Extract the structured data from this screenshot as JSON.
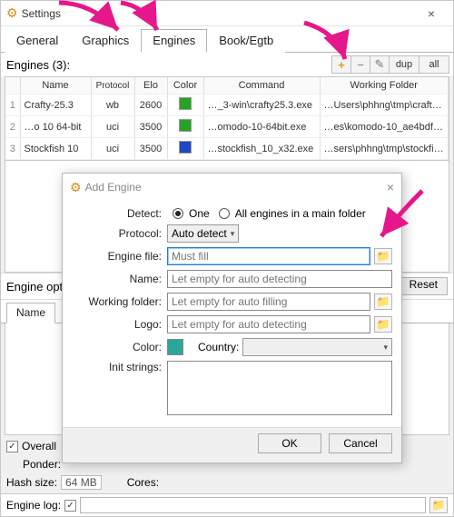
{
  "window": {
    "title": "Settings"
  },
  "tabs": [
    "General",
    "Graphics",
    "Engines",
    "Book/Egtb"
  ],
  "active_tab_index": 2,
  "engines_bar": {
    "label": "Engines (3):",
    "buttons": {
      "plus": "+",
      "minus": "−",
      "edit": "✎",
      "dup": "dup",
      "all": "all"
    }
  },
  "columns": [
    "",
    "Name",
    "Protocol",
    "Elo",
    "Color",
    "Command",
    "Working Folder"
  ],
  "rows": [
    {
      "i": "1",
      "name": "Crafty-25.3",
      "proto": "wb",
      "elo": "2600",
      "color": "#26a326",
      "cmd": "…_3-win\\crafty25.3.exe",
      "wf": "…Users\\phhng\\tmp\\crafty-25_3-win"
    },
    {
      "i": "2",
      "name": "…o 10 64-bit",
      "proto": "uci",
      "elo": "3500",
      "color": "#26a326",
      "cmd": "…omodo-10-64bit.exe",
      "wf": "…es\\komodo-10_ae4bdf\\Windows"
    },
    {
      "i": "3",
      "name": "Stockfish 10",
      "proto": "uci",
      "elo": "3500",
      "color": "#2046c6",
      "cmd": "…stockfish_10_x32.exe",
      "wf": "…sers\\phhng\\tmp\\stockfish-10-win"
    }
  ],
  "engine_options": {
    "label": "Engine opt",
    "reset": "Reset",
    "sub_tabs": [
      "Name"
    ]
  },
  "bottom": {
    "overall": "Overall",
    "ponder": "Ponder:",
    "hash": "Hash size:",
    "hash_val": "64 MB",
    "cores": "Cores:",
    "engine_log": "Engine log:"
  },
  "dialog": {
    "title": "Add Engine",
    "detect_label": "Detect:",
    "detect_one": "One",
    "detect_all": "All engines in a main folder",
    "protocol_label": "Protocol:",
    "protocol_value": "Auto detect",
    "engine_file_label": "Engine file:",
    "engine_file_ph": "Must fill",
    "name_label": "Name:",
    "name_ph": "Let empty for auto detecting",
    "wf_label": "Working folder:",
    "wf_ph": "Let empty for auto filling",
    "logo_label": "Logo:",
    "logo_ph": "Let empty for auto detecting",
    "color_label": "Color:",
    "country_label": "Country:",
    "init_label": "Init strings:",
    "ok": "OK",
    "cancel": "Cancel"
  }
}
